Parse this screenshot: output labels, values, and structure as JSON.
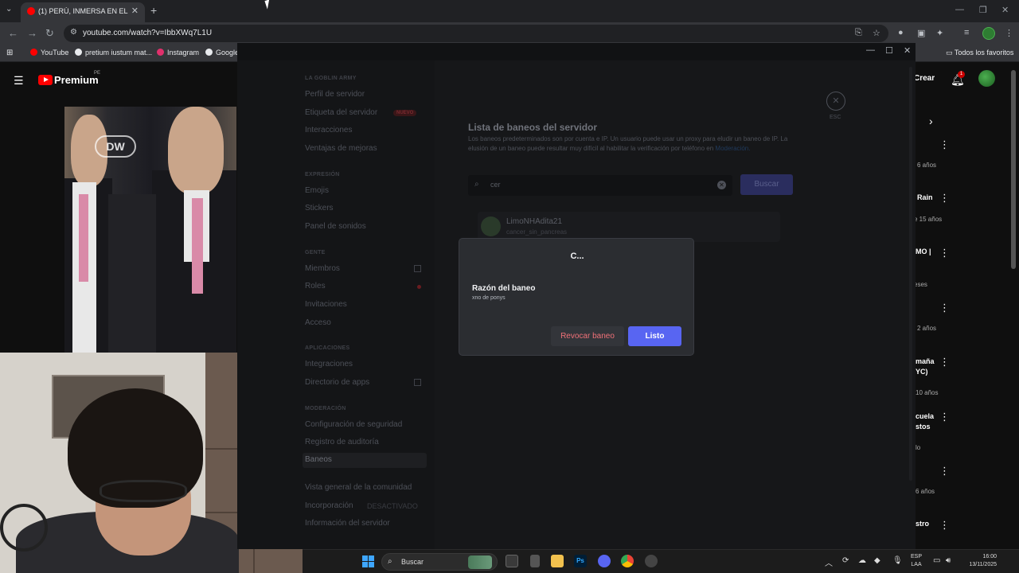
{
  "browser": {
    "tab_title": "(1) PERÚ, INMERSA EN EL CAOS",
    "url": "youtube.com/watch?v=IbbXWq7L1U",
    "bookmarks": [
      {
        "label": "YouTube",
        "color": "#ff0000"
      },
      {
        "label": "pretium iustum mat...",
        "color": "#e8eaed"
      },
      {
        "label": "Instagram",
        "color": "#e1306c"
      },
      {
        "label": "Google",
        "color": "#e8eaed"
      }
    ],
    "all_bookmarks": "Todos los favoritos"
  },
  "youtube": {
    "brand": "Premium",
    "region": "PE",
    "video_logo": "DW",
    "create_label": "Crear",
    "notification_count": "1",
    "sidebar": [
      {
        "title": "",
        "meta": "6 años"
      },
      {
        "title": "Rain",
        "meta": "ce 15 años"
      },
      {
        "title": "MO |",
        "meta": "eses"
      },
      {
        "title": "",
        "meta": "2 años"
      },
      {
        "title": "maña\nYC)",
        "meta": "10 años"
      },
      {
        "title": "cuela\nstos",
        "meta": "lo"
      },
      {
        "title": "",
        "meta": "6 años"
      },
      {
        "title": "stro",
        "meta": ""
      }
    ]
  },
  "discord": {
    "server_name": "LA GOBLIN ARMY",
    "nav": {
      "profile": "Perfil de servidor",
      "server_tag": "Etiqueta del servidor",
      "new_badge": "NUEVO",
      "interactions": "Interacciones",
      "boost_perks": "Ventajas de mejoras",
      "cat_expression": "EXPRESIÓN",
      "emojis": "Emojis",
      "stickers": "Stickers",
      "soundboard": "Panel de sonidos",
      "cat_people": "GENTE",
      "members": "Miembros",
      "roles": "Roles",
      "invites": "Invitaciones",
      "access": "Acceso",
      "cat_apps": "APLICACIONES",
      "integrations": "Integraciones",
      "app_directory": "Directorio de apps",
      "cat_moderation": "MODERACIÓN",
      "safety_setup": "Configuración de seguridad",
      "audit_log": "Registro de auditoría",
      "bans": "Baneos",
      "community_overview": "Vista general de la comunidad",
      "onboarding": "Incorporación",
      "onboarding_status": "DESACTIVADO",
      "server_info": "Información del servidor"
    },
    "bans_page": {
      "title": "Lista de baneos del servidor",
      "description": "Los baneos predeterminados son por cuenta e IP. Un usuario puede usar un proxy para eludir un baneo de IP. La elusión de un baneo puede resultar muy difícil al habilitar la verificación por teléfono en",
      "description_link": "Moderación.",
      "search_value": "cer",
      "search_button": "Buscar",
      "esc_label": "ESC",
      "ban_entry": {
        "name": "LimoNHAdita21",
        "username": "cancer_sin_pancreas"
      }
    },
    "modal": {
      "title": "C...",
      "reason_label": "Razón del baneo",
      "reason_value": "xno de ponys",
      "revoke_button": "Revocar baneo",
      "done_button": "Listo"
    }
  },
  "taskbar": {
    "search_placeholder": "Buscar",
    "lang_top": "ESP",
    "lang_bottom": "LAA",
    "time": "16:00",
    "date": "13/11/2025"
  }
}
